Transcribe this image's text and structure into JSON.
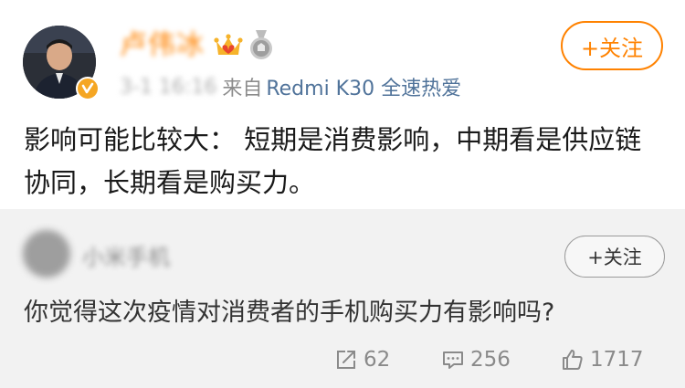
{
  "post": {
    "author_name": "卢伟冰",
    "timestamp": "3-1 16:16",
    "source_prefix": "来自",
    "source_device": "Redmi K30 全速热爱",
    "follow_label": "+关注",
    "text": "影响可能比较大： 短期是消费影响，中期看是供应链协同，长期看是购买力。"
  },
  "retweet": {
    "author_name": "小米手机",
    "follow_label": "+关注",
    "text": "你觉得这次疫情对消费者的手机购买力有影响吗?",
    "stats": {
      "reposts": "62",
      "comments": "256",
      "likes": "1717"
    }
  },
  "icons": {
    "crown": "crown-icon",
    "medal": "medal-icon",
    "verified": "verified-badge-icon",
    "repost": "repost-icon",
    "comment": "comment-icon",
    "like": "thumbs-up-icon"
  },
  "colors": {
    "accent": "#ff8200",
    "link": "#50739a",
    "text": "#1a1a1a",
    "muted": "#8a8a8a",
    "retweet_bg": "#f2f2f2"
  }
}
